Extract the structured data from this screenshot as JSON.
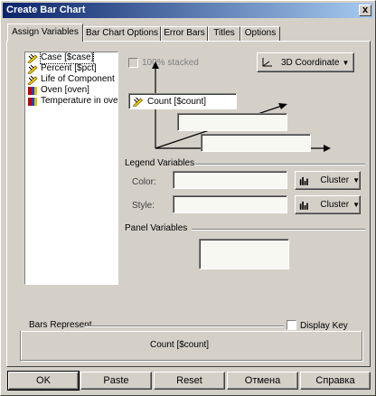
{
  "window": {
    "title": "Create Bar Chart",
    "close_glyph": "x"
  },
  "tabs": [
    {
      "label": "Assign Variables",
      "active": true
    },
    {
      "label": "Bar Chart Options"
    },
    {
      "label": "Error Bars"
    },
    {
      "label": "Titles"
    },
    {
      "label": "Options"
    }
  ],
  "variables": [
    {
      "label": "Case [$case]",
      "icon": "ruler-icon",
      "selected": true
    },
    {
      "label": "Percent [$pct]",
      "icon": "ruler-icon"
    },
    {
      "label": "Life of Component",
      "icon": "ruler-icon"
    },
    {
      "label": "Oven [oven]",
      "icon": "nominal-icon"
    },
    {
      "label": "Temperature in oven",
      "icon": "nominal-icon"
    }
  ],
  "stacked": {
    "label": "100% stacked",
    "checked": false,
    "enabled": false
  },
  "coordinate_button": {
    "label": "3D Coordinate"
  },
  "axes": {
    "y_field_value": "Count [$count]"
  },
  "legend": {
    "title": "Legend Variables",
    "color_label": "Color:",
    "style_label": "Style:",
    "color_mode": "Cluster",
    "style_mode": "Cluster"
  },
  "panel": {
    "title": "Panel Variables"
  },
  "bars_represent": {
    "title": "Bars Represent",
    "value": "Count [$count]",
    "display_key_label": "Display Key",
    "display_key_checked": false
  },
  "buttons": {
    "ok": "OK",
    "paste": "Paste",
    "reset": "Reset",
    "cancel": "Отмена",
    "help": "Справка"
  },
  "colors": {
    "title_start": "#0a246a",
    "title_end": "#a6caf0",
    "face": "#d4d0c8"
  }
}
